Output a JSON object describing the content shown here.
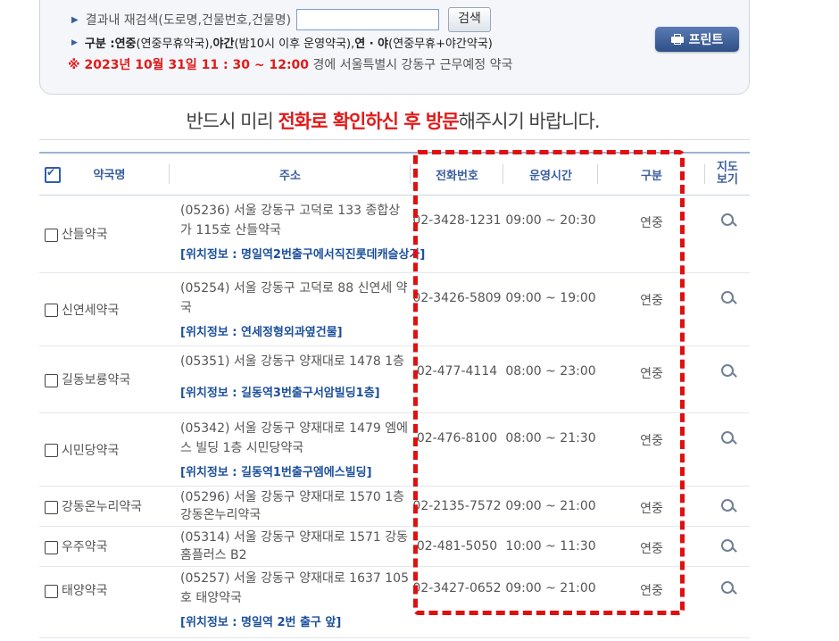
{
  "search": {
    "label": "결과내 재검색(도로명,건물번호,건물명)",
    "value": "",
    "button": "검색"
  },
  "legend": {
    "prefix": "구분 : ",
    "yeonjung": "연중",
    "yeonjung_desc": "(연중무휴약국), ",
    "yagan": "야간",
    "yagan_desc": "(밤10시 이후 운영약국), ",
    "yeonya": "연 · 야",
    "yeonya_desc": "(연중무휴+야간약국)"
  },
  "date_line": {
    "red": "※ 2023년 10월 31일 11 : 30 ~ 12:00",
    "rest": " 경에  서울특별시  강동구   근무예정 약국"
  },
  "print_button": "프린트",
  "notice": {
    "part1": "반드시 미리 ",
    "red": "전화로 확인하신 후 방문",
    "part2": "해주시기 바랍니다."
  },
  "table": {
    "headers": [
      "약국명",
      "주소",
      "전화번호",
      "운영시간",
      "구분",
      "지도보기"
    ],
    "rows": [
      {
        "name": "산들약국",
        "address": "(05236) 서울 강동구 고덕로 133 종합상가 115호 산들약국",
        "location": "[위치정보 : 명일역2번출구에서직진롯데캐슬상가]",
        "phone": "02-3428-1231",
        "hours": "09:00 ~ 20:30",
        "type": "연중"
      },
      {
        "name": "신연세약국",
        "address": "(05254) 서울 강동구 고덕로 88 신연세 약국",
        "location": "[위치정보 : 연세정형외과옆건물]",
        "phone": "02-3426-5809",
        "hours": "09:00 ~ 19:00",
        "type": "연중"
      },
      {
        "name": "길동보룡약국",
        "address": "(05351) 서울 강동구 양재대로 1478 1층",
        "location": "[위치정보 : 길동역3번출구서암빌딩1층]",
        "phone": "02-477-4114",
        "hours": "08:00 ~ 23:00",
        "type": "연중"
      },
      {
        "name": "시민당약국",
        "address": "(05342) 서울 강동구 양재대로 1479 엠에스 빌딩 1층 시민당약국",
        "location": "[위치정보 : 길동역1번출구엠에스빌딩]",
        "phone": "02-476-8100",
        "hours": "08:00 ~ 21:30",
        "type": "연중"
      },
      {
        "name": "강동온누리약국",
        "address": "(05296) 서울 강동구 양재대로 1570 1층 강동온누리약국",
        "location": "",
        "phone": "02-2135-7572",
        "hours": "09:00 ~ 21:00",
        "type": "연중"
      },
      {
        "name": "우주약국",
        "address": "(05314) 서울 강동구 양재대로 1571 강동홈플러스 B2",
        "location": "",
        "phone": "02-481-5050",
        "hours": "10:00 ~ 11:30",
        "type": "연중"
      },
      {
        "name": "태양약국",
        "address": "(05257) 서울 강동구 양재대로 1637 105호 태양약국",
        "location": "[위치정보 : 명일역 2번 출구 앞]",
        "phone": "02-3427-0652",
        "hours": "09:00 ~ 21:00",
        "type": "연중"
      }
    ]
  },
  "colors": {
    "accent": "#e11b1b",
    "link": "#1b4f9c",
    "header": "#3a5ea0",
    "highlight": "#e01010"
  }
}
